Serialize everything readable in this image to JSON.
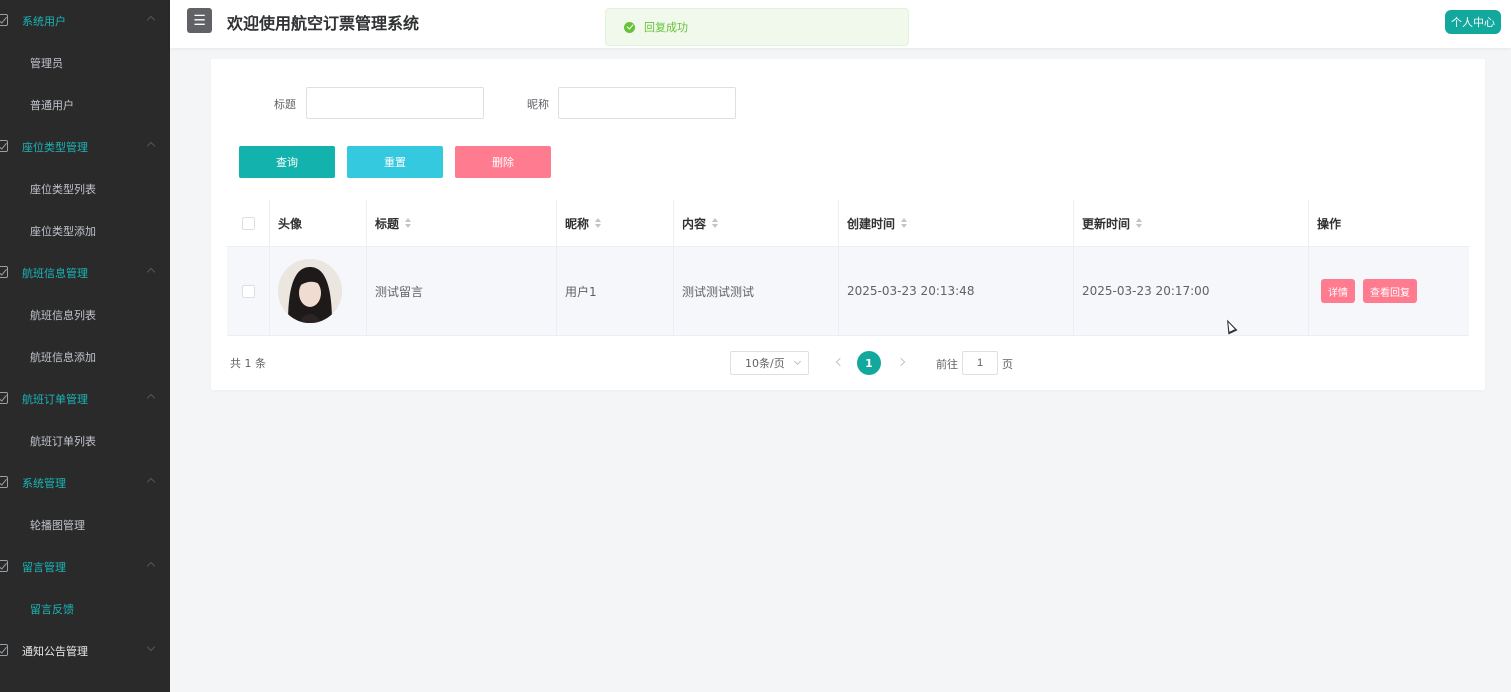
{
  "header": {
    "menu_icon": "hamburger-icon",
    "title": "欢迎使用航空订票管理系统",
    "user_center_label": "个人中心"
  },
  "toast": {
    "icon": "check-circle-icon",
    "message": "回复成功"
  },
  "sidebar": {
    "groups": [
      {
        "label": "系统用户",
        "items": [
          "管理员",
          "普通用户"
        ]
      },
      {
        "label": "座位类型管理",
        "items": [
          "座位类型列表",
          "座位类型添加"
        ]
      },
      {
        "label": "航班信息管理",
        "items": [
          "航班信息列表",
          "航班信息添加"
        ]
      },
      {
        "label": "航班订单管理",
        "items": [
          "航班订单列表"
        ]
      },
      {
        "label": "系统管理",
        "items": [
          "轮播图管理"
        ]
      },
      {
        "label": "留言管理",
        "items": [
          "留言反馈"
        ]
      },
      {
        "label": "通知公告管理",
        "items": []
      }
    ],
    "active_item": "留言反馈"
  },
  "search": {
    "title_label": "标题",
    "title_value": "",
    "nickname_label": "昵称",
    "nickname_value": "",
    "query_label": "查询",
    "reset_label": "重置",
    "delete_label": "删除"
  },
  "table": {
    "headers": {
      "avatar": "头像",
      "title": "标题",
      "nickname": "昵称",
      "content": "内容",
      "created": "创建时间",
      "updated": "更新时间",
      "ops": "操作"
    },
    "rows": [
      {
        "title": "测试留言",
        "nickname": "用户1",
        "content": "测试测试测试",
        "created": "2025-03-23 20:13:48",
        "updated": "2025-03-23 20:17:00",
        "detail_label": "详情",
        "reply_label": "查看回复"
      }
    ]
  },
  "pagination": {
    "total_text": "共 1 条",
    "page_size": "10条/页",
    "current_page": "1",
    "goto_label": "前往",
    "goto_value": "1",
    "goto_suffix": "页"
  },
  "colors": {
    "accent": "#13a89e",
    "danger": "#ff7b8f",
    "info": "#34c9de",
    "sidebar_bg": "#2a2a2b"
  }
}
